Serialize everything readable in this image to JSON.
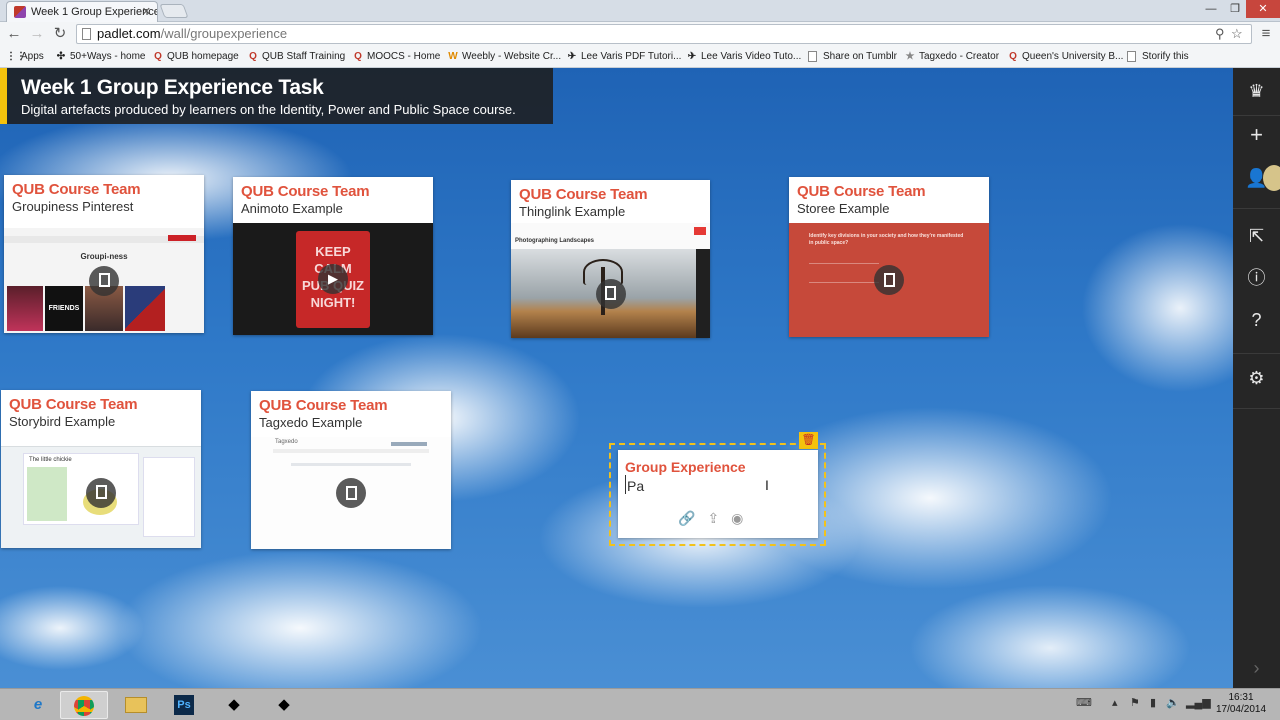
{
  "browser": {
    "tab_title": "Week 1 Group Experience",
    "url_domain": "padlet.com",
    "url_path": "/wall/groupexperience",
    "bookmarks": [
      "Apps",
      "50+Ways - home",
      "QUB homepage",
      "QUB Staff Training",
      "MOOCS - Home",
      "Weebly - Website Cr...",
      "Lee Varis PDF Tutori...",
      "Lee Varis Video Tuto...",
      "Share on Tumblr",
      "Tagxedo - Creator",
      "Queen's University B...",
      "Storify this"
    ]
  },
  "wall": {
    "title": "Week 1 Group Experience Task",
    "subtitle": "Digital artefacts produced by learners on the Identity, Power and Public Space course."
  },
  "cards": [
    {
      "author": "QUB Course Team",
      "title": "Groupiness Pinterest",
      "thumb_caption": "Groupi-ness",
      "thumb_text": "FRIENDS"
    },
    {
      "author": "QUB Course Team",
      "title": "Animoto Example",
      "poster_lines": [
        "KEEP",
        "CALM",
        "PUB QUIZ",
        "NIGHT!"
      ]
    },
    {
      "author": "QUB Course Team",
      "title": "Thinglink Example",
      "thumb_caption": "Photographing Landscapes"
    },
    {
      "author": "QUB Course Team",
      "title": "Storee Example",
      "thumb_caption": "Identify key divisions in your society and how they're manifested in public space?"
    },
    {
      "author": "QUB Course Team",
      "title": "Storybird Example",
      "thumb_caption": "The little chickie"
    },
    {
      "author": "QUB Course Team",
      "title": "Tagxedo Example",
      "thumb_caption": "Tagxedo"
    }
  ],
  "editing_card": {
    "title": "Group Experience",
    "body": "Pa"
  },
  "taskbar": {
    "time": "16:31",
    "date": "17/04/2014"
  },
  "colors": {
    "accent": "#f4c20d",
    "card_author": "#e0533d",
    "sidebar_bg": "#262626"
  }
}
